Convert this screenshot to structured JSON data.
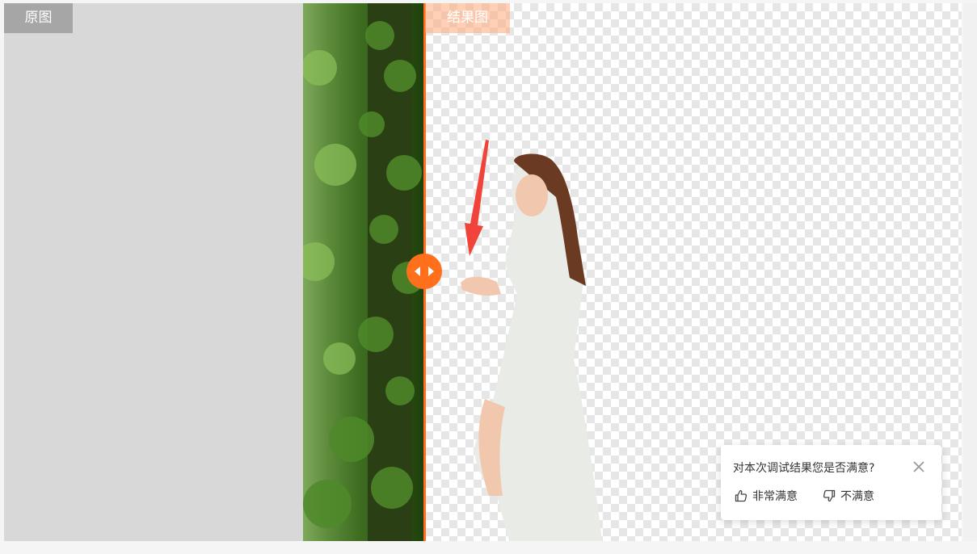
{
  "labels": {
    "original": "原图",
    "result": "结果图"
  },
  "feedback": {
    "question": "对本次调试结果您是否满意?",
    "satisfied": "非常满意",
    "unsatisfied": "不满意"
  },
  "colors": {
    "accent": "#ff6f1c",
    "arrow": "#f0443a",
    "original_label_bg": "#a6a6a6",
    "gray_panel": "#d8d8d8"
  },
  "icons": {
    "handle": "left-right-arrows-icon",
    "close": "close-icon",
    "satisfied": "thumbs-up-icon",
    "unsatisfied": "thumbs-down-icon"
  }
}
